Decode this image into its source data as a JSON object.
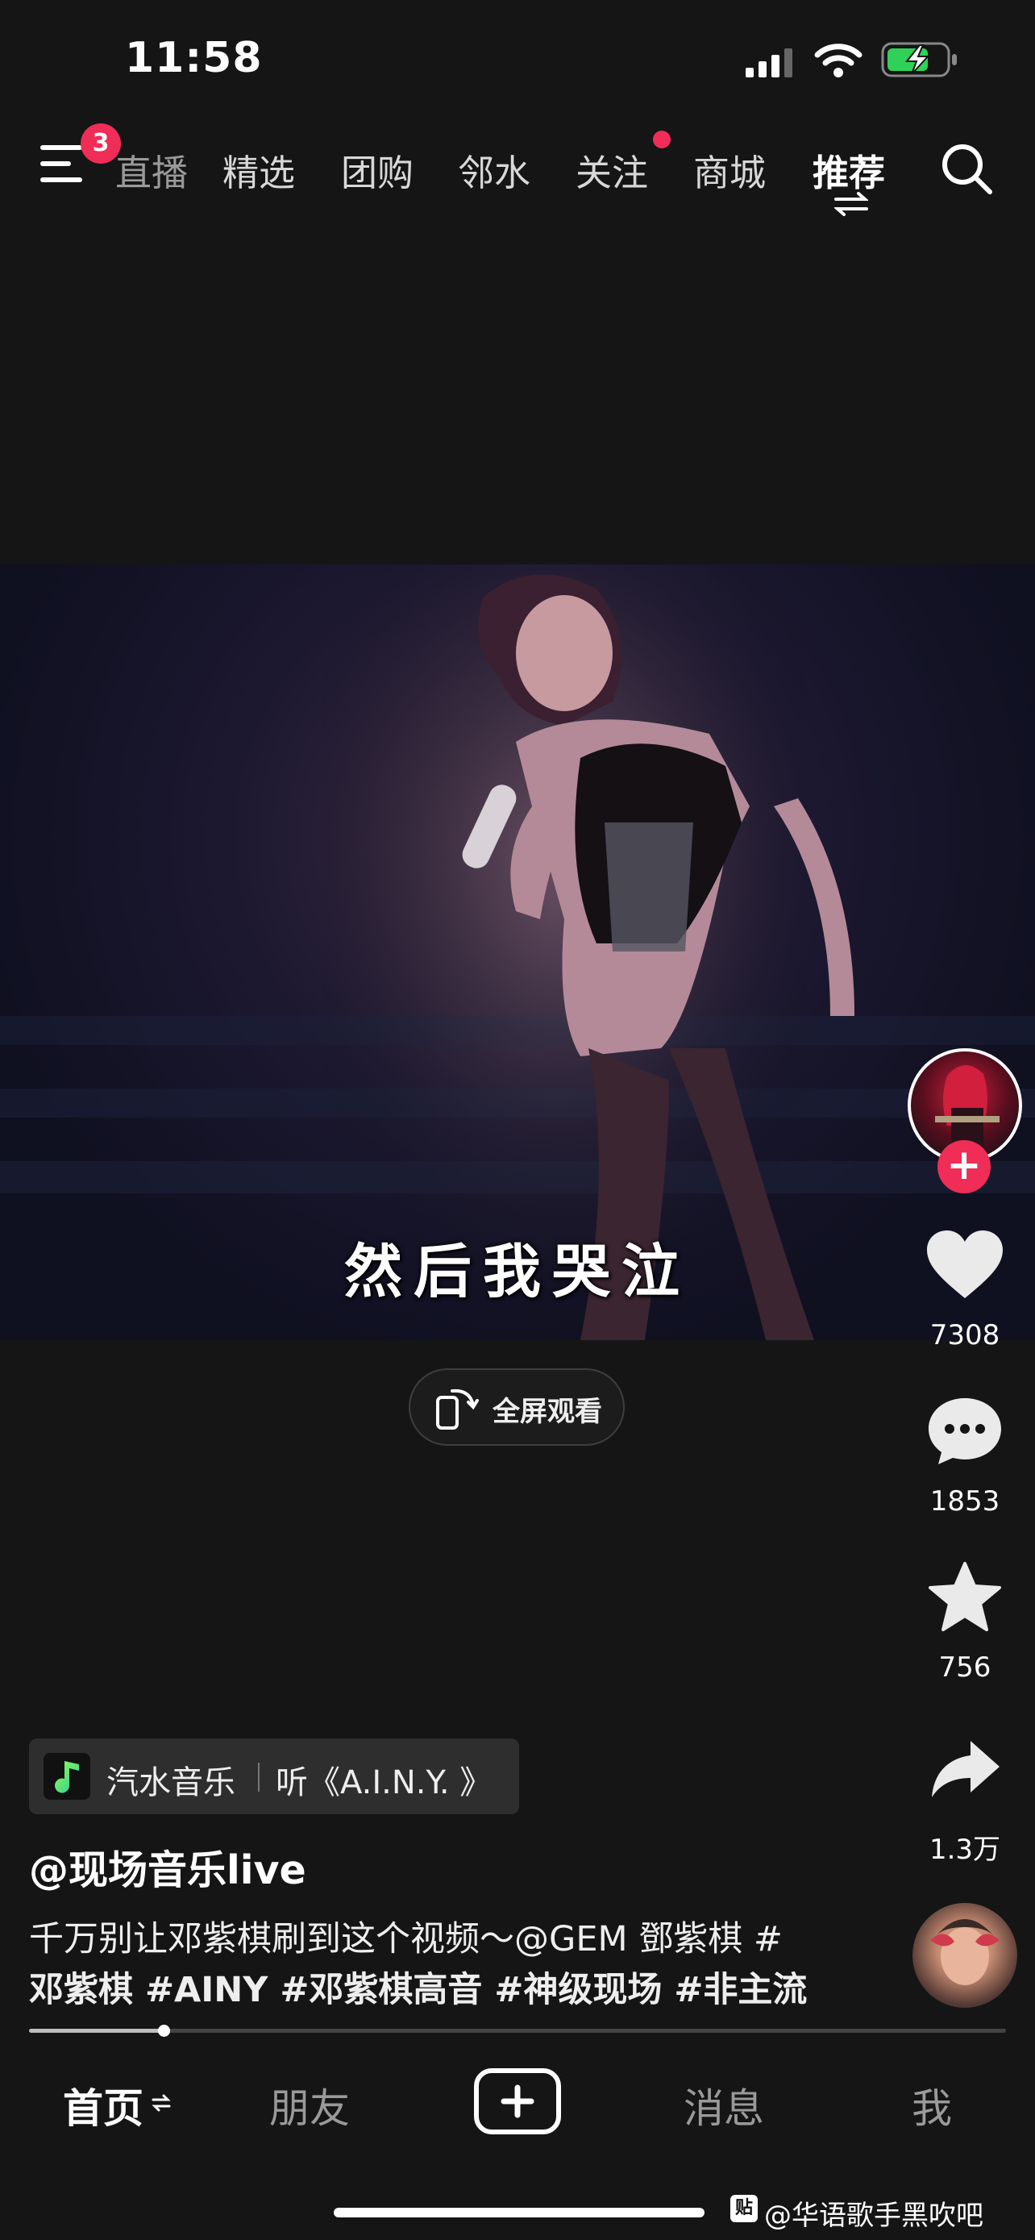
{
  "status_bar": {
    "time": "11:58"
  },
  "top_nav": {
    "menu_badge": "3",
    "tabs": [
      "直播",
      "精选",
      "团购",
      "邻水",
      "关注",
      "商城",
      "推荐"
    ],
    "active_tab": "推荐"
  },
  "video": {
    "subtitle": "然后我哭泣",
    "fullscreen_label": "全屏观看"
  },
  "actions": {
    "likes": "7308",
    "comments": "1853",
    "favorites": "756",
    "shares": "1.3万"
  },
  "music_tag": {
    "app": "汽水音乐",
    "song": "听《A.I.N.Y. 》"
  },
  "post": {
    "author": "@现场音乐live",
    "description_line1": "千万别让邓紫棋刷到这个视频～@GEM 鄧紫棋 #",
    "description_line2": "邓紫棋 #AINY #邓紫棋高音 #神级现场 #非主流",
    "progress": 0.138
  },
  "bottom_nav": {
    "home": "首页",
    "friends": "朋友",
    "messages": "消息",
    "me": "我"
  },
  "watermark": {
    "icon_text": "贴",
    "text": "@华语歌手黑吹吧"
  },
  "colors": {
    "background": "#151515",
    "accent": "#ef2d56",
    "battery": "#2fd158"
  },
  "icons": [
    "menu-icon",
    "search-icon",
    "swap-icon",
    "rotate-phone-icon",
    "heart-icon",
    "comment-icon",
    "star-icon",
    "share-icon",
    "plus-icon"
  ]
}
